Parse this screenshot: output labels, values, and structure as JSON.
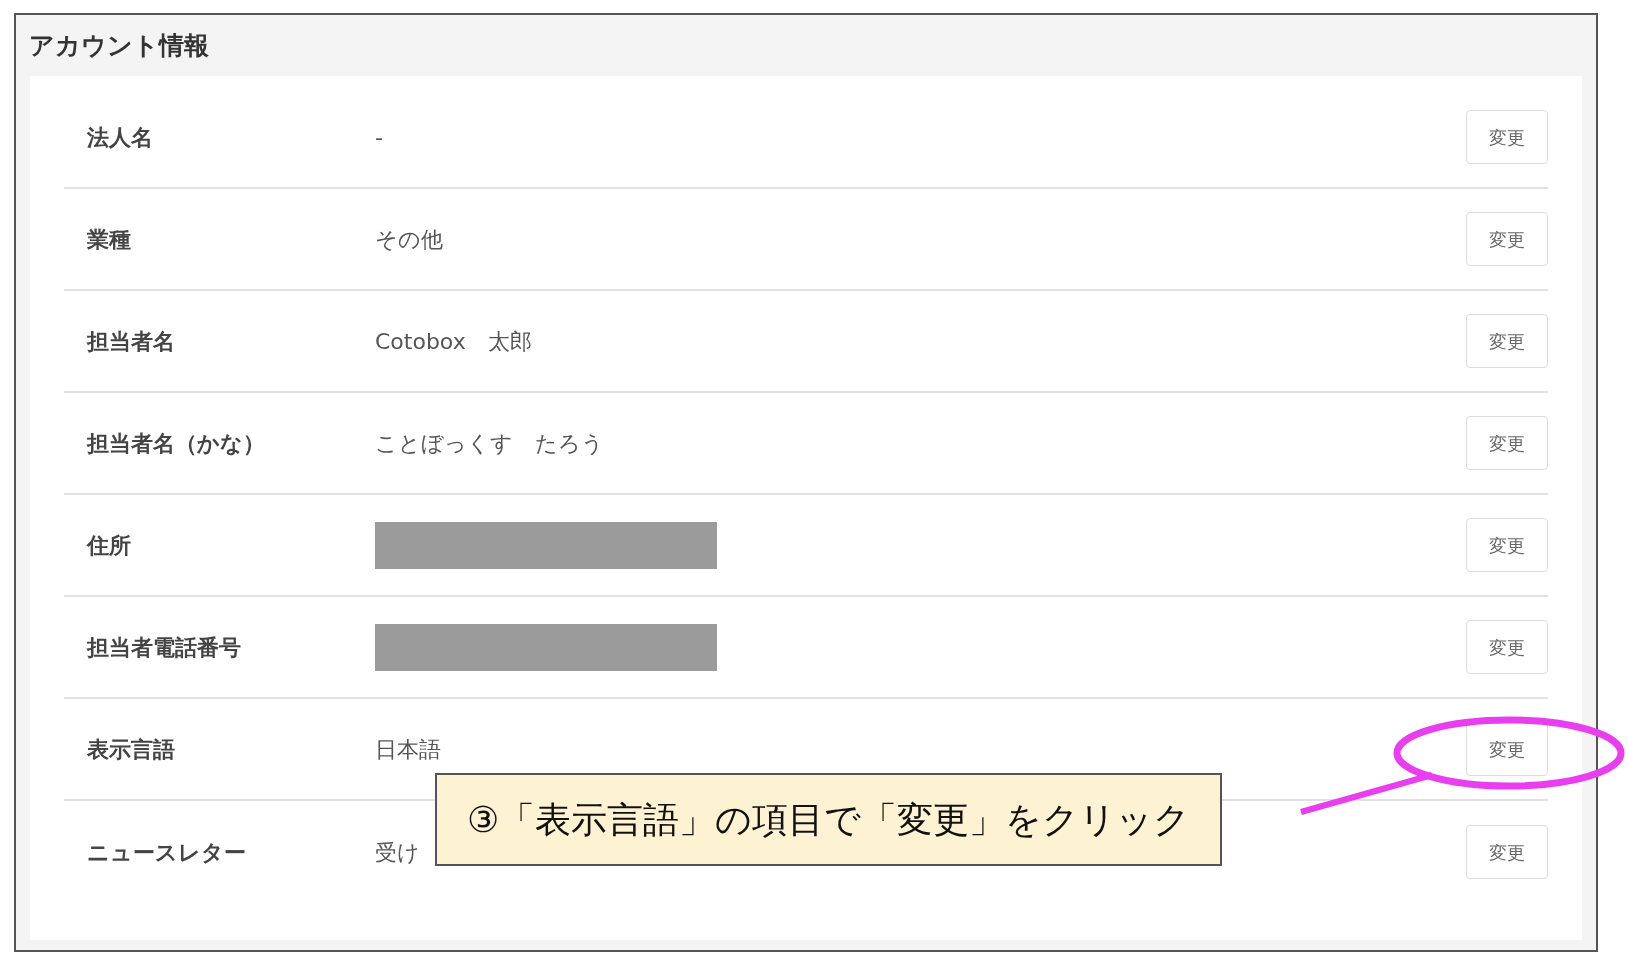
{
  "panel": {
    "title": "アカウント情報"
  },
  "rows": [
    {
      "label": "法人名",
      "kind": "text",
      "value": "-",
      "button": "変更"
    },
    {
      "label": "業種",
      "kind": "text",
      "value": "その他",
      "button": "変更"
    },
    {
      "label": "担当者名",
      "kind": "text",
      "value": "Cotobox　太郎",
      "button": "変更"
    },
    {
      "label": "担当者名（かな）",
      "kind": "text",
      "value": "ことぼっくす　たろう",
      "button": "変更"
    },
    {
      "label": "住所",
      "kind": "redacted",
      "button": "変更"
    },
    {
      "label": "担当者電話番号",
      "kind": "redacted",
      "button": "変更"
    },
    {
      "label": "表示言語",
      "kind": "text",
      "value": "日本語",
      "button": "変更"
    },
    {
      "label": "ニュースレター",
      "kind": "text",
      "value": "受け",
      "button": "変更"
    }
  ],
  "annotation": {
    "text": "③「表示言語」の項目で「変更」をクリック"
  }
}
